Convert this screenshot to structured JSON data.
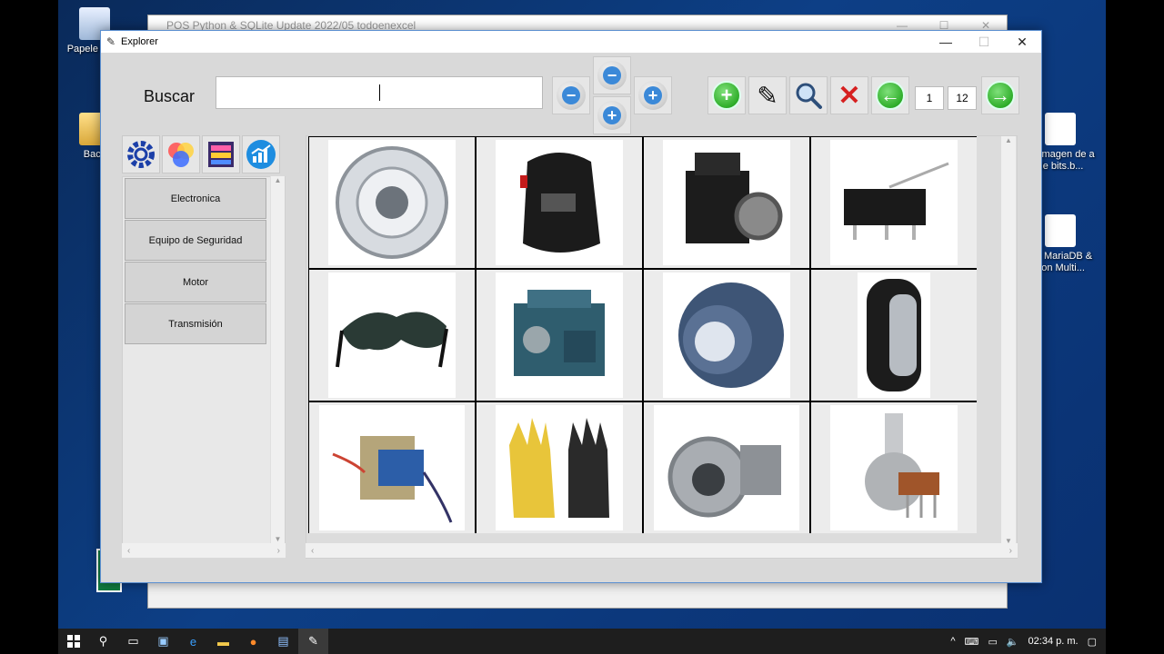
{
  "desktop": {
    "icons_left": [
      {
        "label": "Papelera de reciclaje",
        "short": "Papele recic"
      },
      {
        "label": "Back",
        "short": "Back"
      }
    ],
    "icons_right": [
      {
        "label": "va imagen de a de bits.b..."
      },
      {
        "label": "avi MariaDB & hon Multi..."
      }
    ]
  },
  "background_window": {
    "title": "POS Python & SQLite Update 2022/05 todoenexcel",
    "controls": [
      "—",
      "☐",
      "✕"
    ]
  },
  "window": {
    "title": "Explorer",
    "controls": {
      "minimize": "—",
      "maximize": "☐",
      "close": "✕"
    }
  },
  "search": {
    "label": "Buscar",
    "value": ""
  },
  "toolbar": {
    "zoom": {
      "minus_left": "−",
      "minus_top": "−",
      "plus_bottom": "+",
      "plus_right": "+"
    },
    "actions": [
      {
        "name": "add",
        "symbol": "+",
        "color": "#2fae2a"
      },
      {
        "name": "edit",
        "symbol": "✎",
        "color": "#111111"
      },
      {
        "name": "search",
        "symbol": "🔍",
        "color": "#2e4f7a"
      },
      {
        "name": "delete",
        "symbol": "✕",
        "color": "#d62020"
      }
    ],
    "pagination": {
      "prev": "←",
      "current_page": "1",
      "total_pages": "12",
      "next": "→"
    }
  },
  "categories": {
    "icons": [
      "gear-icon",
      "color-wheel-icon",
      "layers-icon",
      "chart-icon"
    ],
    "items": [
      "Electronica",
      "Equipo de Seguridad",
      "Motor",
      "Transmisión"
    ]
  },
  "products": [
    {
      "icon": "wheel-rim"
    },
    {
      "icon": "welding-helmet"
    },
    {
      "icon": "air-compressor"
    },
    {
      "icon": "micro-switch"
    },
    {
      "icon": "safety-glasses"
    },
    {
      "icon": "diesel-engine"
    },
    {
      "icon": "brake-drum"
    },
    {
      "icon": "tire"
    },
    {
      "icon": "transformer"
    },
    {
      "icon": "work-gloves"
    },
    {
      "icon": "turbocharger"
    },
    {
      "icon": "potentiometer"
    }
  ],
  "taskbar": {
    "time": "02:34 p. m."
  }
}
